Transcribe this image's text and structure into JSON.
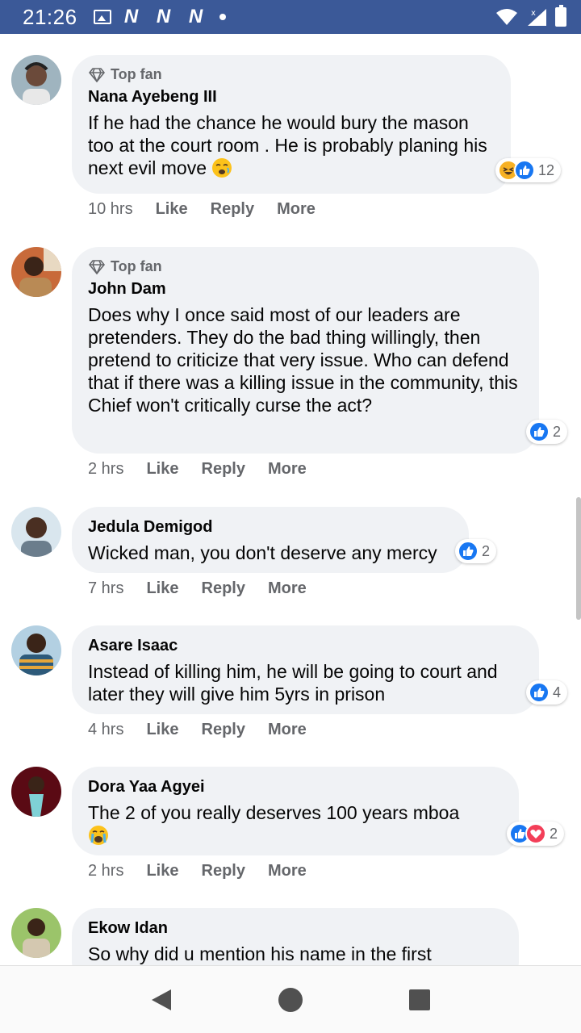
{
  "status_bar": {
    "time": "21:26",
    "notification_icons": [
      "N",
      "N",
      "N"
    ],
    "icons": [
      "image-icon",
      "wifi-icon",
      "signal-icon",
      "battery-icon"
    ]
  },
  "colors": {
    "header": "#3b5998",
    "bubble": "#f0f2f5",
    "like": "#1877f2",
    "love": "#f33e58",
    "haha": "#f7b125",
    "meta_text": "#65676b"
  },
  "comments": [
    {
      "badge": "Top fan",
      "author": "Nana Ayebeng III",
      "text": "If he had the chance he would bury the mason too at the court room . He is probably planing his next evil move",
      "emoji": "weary-face",
      "time": "10 hrs",
      "like": "Like",
      "reply": "Reply",
      "more": "More",
      "reactions": [
        "haha",
        "like"
      ],
      "reaction_count": "12"
    },
    {
      "badge": "Top fan",
      "author": "John Dam",
      "text": "Does why I once said most of our leaders are pretenders. They do the bad thing willingly, then pretend to criticize that very issue. Who can defend that if there was a killing issue in the community, this Chief won't critically curse the act?",
      "time": "2 hrs",
      "like": "Like",
      "reply": "Reply",
      "more": "More",
      "reactions": [
        "like"
      ],
      "reaction_count": "2"
    },
    {
      "author": "Jedula Demigod",
      "text": "Wicked man, you don't deserve any mercy",
      "time": "7 hrs",
      "like": "Like",
      "reply": "Reply",
      "more": "More",
      "reactions": [
        "like"
      ],
      "reaction_count": "2"
    },
    {
      "author": "Asare Isaac",
      "text": "Instead of killing him, he will be going to court and later they will give him 5yrs in prison",
      "time": "4 hrs",
      "like": "Like",
      "reply": "Reply",
      "more": "More",
      "reactions": [
        "like"
      ],
      "reaction_count": "4"
    },
    {
      "author": "Dora Yaa Agyei",
      "text": "The 2 of you really deserves 100 years mboa",
      "emoji": "crying-face",
      "time": "2 hrs",
      "like": "Like",
      "reply": "Reply",
      "more": "More",
      "reactions": [
        "like",
        "love"
      ],
      "reaction_count": "2"
    },
    {
      "author": "Ekow Idan",
      "text": "So why did u mention his name in the first"
    }
  ],
  "nav": [
    "back-button",
    "home-button",
    "recents-button"
  ]
}
